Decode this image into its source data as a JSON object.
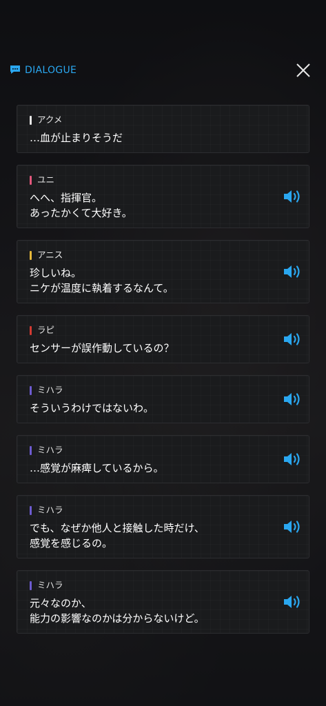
{
  "header": {
    "title": "DIALOGUE",
    "icon": "chat-bubble-icon",
    "accent_color": "#2aa7f0"
  },
  "dialogue": [
    {
      "speaker": "アクメ",
      "color": "#e6e6e6",
      "text": "…血が止まりそうだ",
      "has_voice": false
    },
    {
      "speaker": "ユニ",
      "color": "#e2577c",
      "text": "へへ、指揮官。\nあったかくて大好き。",
      "has_voice": true
    },
    {
      "speaker": "アニス",
      "color": "#e8b93a",
      "text": "珍しいね。\nニケが温度に執着するなんて。",
      "has_voice": true
    },
    {
      "speaker": "ラピ",
      "color": "#d23a32",
      "text": "センサーが誤作動しているの？",
      "has_voice": true
    },
    {
      "speaker": "ミハラ",
      "color": "#6d5bd0",
      "text": "そういうわけではないわ。",
      "has_voice": true
    },
    {
      "speaker": "ミハラ",
      "color": "#6d5bd0",
      "text": "…感覚が麻痺しているから。",
      "has_voice": true
    },
    {
      "speaker": "ミハラ",
      "color": "#6d5bd0",
      "text": "でも、なぜか他人と接触した時だけ、\n感覚を感じるの。",
      "has_voice": true
    },
    {
      "speaker": "ミハラ",
      "color": "#6d5bd0",
      "text": "元々なのか、\n能力の影響なのかは分からないけど。",
      "has_voice": true
    }
  ],
  "voice_icon_color": "#2aa7f0"
}
